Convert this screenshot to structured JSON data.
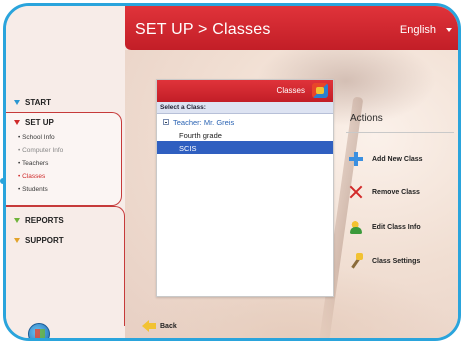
{
  "header": {
    "title": "SET UP > Classes",
    "language": "English"
  },
  "sidebar": {
    "start": "START",
    "setup": "SET UP",
    "setup_items": [
      "School Info",
      "Computer Info",
      "Teachers",
      "Classes",
      "Students"
    ],
    "reports": "REPORTS",
    "support": "SUPPORT"
  },
  "classes_panel": {
    "title": "Classes",
    "select_label": "Select a Class:",
    "teacher": "Teacher: Mr. Greis",
    "items": [
      "Fourth grade",
      "SCIS"
    ]
  },
  "actions": {
    "title": "Actions",
    "items": [
      "Add New Class",
      "Remove Class",
      "Edit Class Info",
      "Class Settings"
    ]
  },
  "back_label": "Back",
  "colors": {
    "header_red": "#c21e27",
    "frame_blue": "#2aa4dc",
    "selection_blue": "#2f5fc0"
  }
}
